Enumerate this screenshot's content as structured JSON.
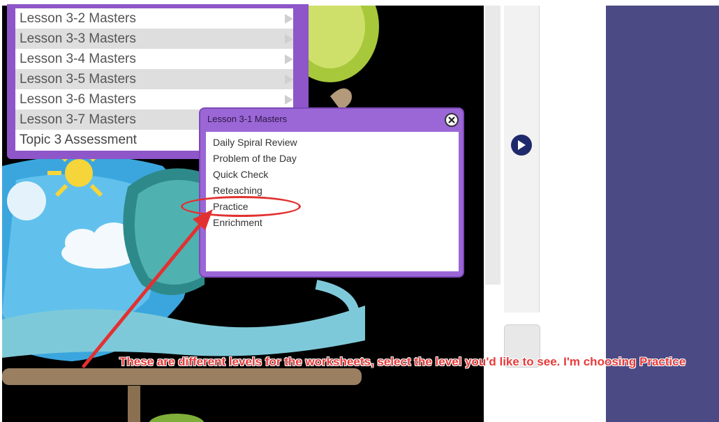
{
  "lesson_menu": {
    "items": [
      {
        "label": "Lesson 3-2 Masters"
      },
      {
        "label": "Lesson 3-3 Masters"
      },
      {
        "label": "Lesson 3-4 Masters"
      },
      {
        "label": "Lesson 3-5 Masters"
      },
      {
        "label": "Lesson 3-6 Masters"
      },
      {
        "label": "Lesson 3-7 Masters"
      },
      {
        "label": "Topic 3 Assessment"
      }
    ]
  },
  "masters_popup": {
    "title": "Lesson 3-1 Masters",
    "items": [
      {
        "label": "Daily Spiral Review"
      },
      {
        "label": "Problem of the Day"
      },
      {
        "label": "Quick Check"
      },
      {
        "label": "Reteaching"
      },
      {
        "label": "Practice"
      },
      {
        "label": "Enrichment"
      }
    ]
  },
  "annotation": {
    "text": "These are different levels for the worksheets, select the level you'd like to see.  I'm choosing Practice",
    "color": "#e83a3a"
  },
  "colors": {
    "menu_purple": "#8e56c9",
    "popup_purple": "#9b66d6",
    "side_panel": "#4b4a84",
    "next_button": "#1f2a6b"
  }
}
